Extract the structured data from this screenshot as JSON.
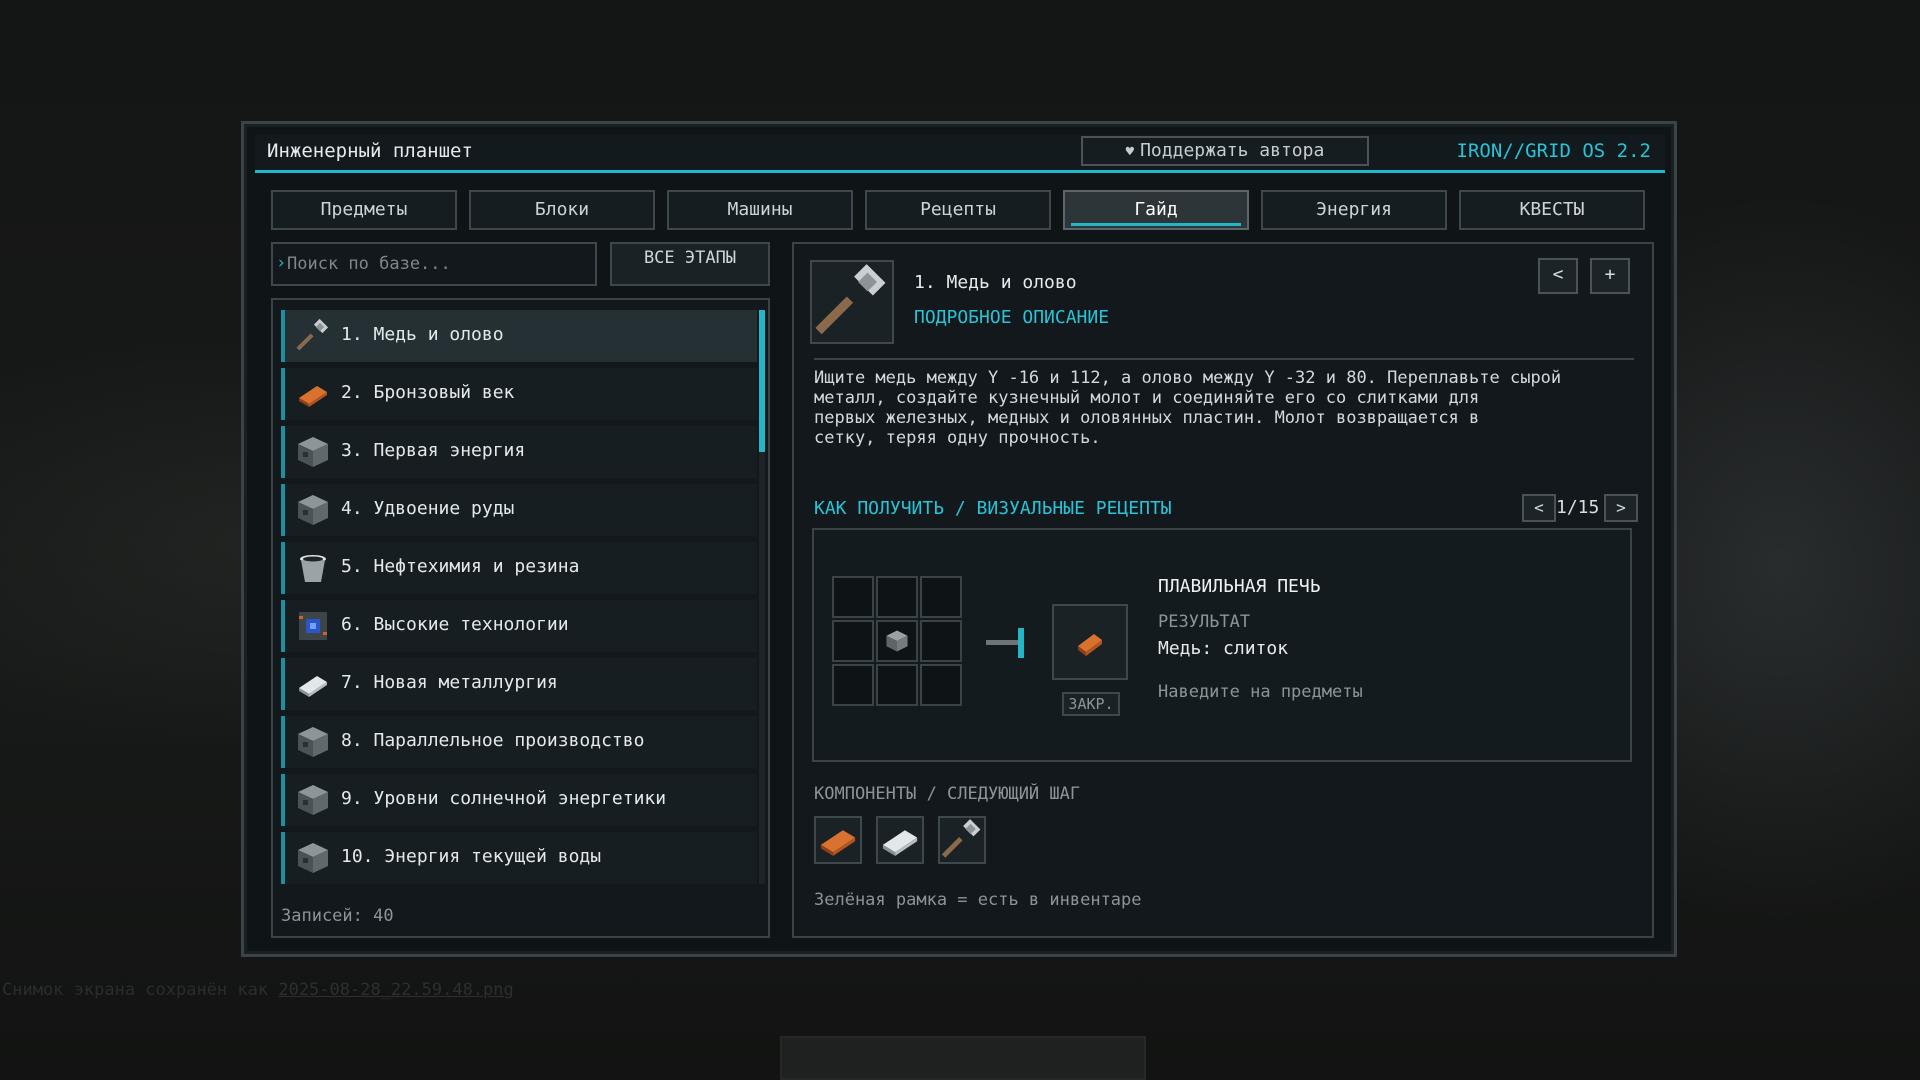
{
  "window": {
    "title": "Инженерный планшет",
    "support_button": "Поддержать автора",
    "os_label": "IRON//GRID OS 2.2"
  },
  "tabs": [
    {
      "label": "Предметы"
    },
    {
      "label": "Блоки"
    },
    {
      "label": "Машины"
    },
    {
      "label": "Рецепты"
    },
    {
      "label": "Гайд",
      "active": true
    },
    {
      "label": "Энергия"
    },
    {
      "label": "КВЕСТЫ"
    }
  ],
  "search": {
    "placeholder": "Поиск по базе...",
    "value": ""
  },
  "all_stages_button": "ВСЕ ЭТАПЫ",
  "stages": [
    {
      "label": "1. Медь и олово",
      "icon": "hammer-icon",
      "selected": true
    },
    {
      "label": "2. Бронзовый век",
      "icon": "copper-ingot-icon"
    },
    {
      "label": "3. Первая энергия",
      "icon": "machine-block-icon"
    },
    {
      "label": "4. Удвоение руды",
      "icon": "machine-block-icon"
    },
    {
      "label": "5. Нефтехимия и резина",
      "icon": "bucket-icon"
    },
    {
      "label": "6. Высокие технологии",
      "icon": "circuit-block-icon"
    },
    {
      "label": "7. Новая металлургия",
      "icon": "steel-ingot-icon"
    },
    {
      "label": "8. Параллельное производство",
      "icon": "machine-block-icon"
    },
    {
      "label": "9. Уровни солнечной энергетики",
      "icon": "machine-block-icon"
    },
    {
      "label": "10. Энергия текущей воды",
      "icon": "machine-block-icon"
    }
  ],
  "records_count": "Записей: 40",
  "detail": {
    "title": "1. Медь и олово",
    "link": "ПОДРОБНОЕ ОПИСАНИЕ",
    "prev_button": "<",
    "add_button": "+",
    "description": "Ищите медь между Y -16 и 112, а олово между Y -32 и 80. Переплавьте сырой\nметалл, создайте кузнечный молот и соединяйте его со слитками для\nпервых железных, медных и оловянных пластин. Молот возвращается в\nсетку, теряя одну прочность."
  },
  "recipes": {
    "header": "КАК ПОЛУЧИТЬ / ВИЗУАЛЬНЫЕ РЕЦЕПТЫ",
    "pager": {
      "prev": "<",
      "text": "1/15",
      "next": ">"
    },
    "machine": "ПЛАВИЛЬНАЯ ПЕЧЬ",
    "result_label": "РЕЗУЛЬТАТ",
    "result_value": "Медь: слиток",
    "hint": "Наведите на предметы",
    "lock_tag": "ЗАКР.",
    "input_item": "raw-ore-icon",
    "output_item": "copper-ingot-icon"
  },
  "components": {
    "header": "КОМПОНЕНТЫ / СЛЕДУЮЩИЙ ШАГ",
    "items": [
      "copper-ingot-icon",
      "tin-ingot-icon",
      "hammer-icon"
    ]
  },
  "legend": "Зелёная рамка = есть в инвентаре",
  "colors": {
    "accent": "#23b6c8",
    "background": "#0f1416",
    "text": "#d7dde0"
  }
}
